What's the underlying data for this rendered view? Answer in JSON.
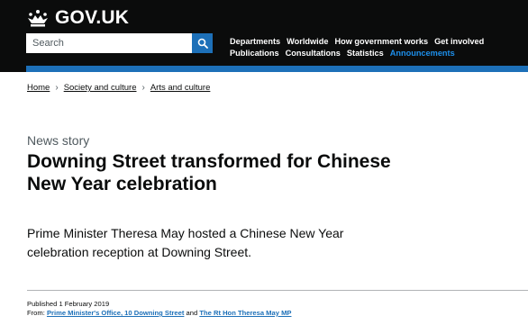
{
  "header": {
    "logo_text": "GOV.UK",
    "search_placeholder": "Search",
    "nav_row1": [
      {
        "label": "Departments"
      },
      {
        "label": "Worldwide"
      },
      {
        "label": "How government works"
      },
      {
        "label": "Get involved"
      }
    ],
    "nav_row2": [
      {
        "label": "Publications"
      },
      {
        "label": "Consultations"
      },
      {
        "label": "Statistics"
      },
      {
        "label": "Announcements"
      }
    ],
    "nav_active": "Announcements"
  },
  "breadcrumb": [
    {
      "label": "Home"
    },
    {
      "label": "Society and culture"
    },
    {
      "label": "Arts and culture"
    }
  ],
  "article": {
    "caption": "News story",
    "title": "Downing Street transformed for Chinese New Year celebration",
    "lede": "Prime Minister Theresa May hosted a Chinese New Year celebration reception at Downing Street.",
    "published": "Published 1 February 2019",
    "from_label": "From:",
    "from_orgs": [
      "Prime Minister's Office, 10 Downing Street",
      "The Rt Hon Theresa May MP"
    ],
    "from_joiner": "and"
  },
  "colors": {
    "header_bg": "#0b0c0c",
    "accent_blue": "#1d70b8",
    "active_nav": "#1d8feb",
    "text": "#0b0c0c",
    "secondary_text": "#505a5f"
  },
  "icons": {
    "logo": "crown-icon",
    "search": "search-icon",
    "breadcrumb_separator": "chevron-right-icon"
  }
}
